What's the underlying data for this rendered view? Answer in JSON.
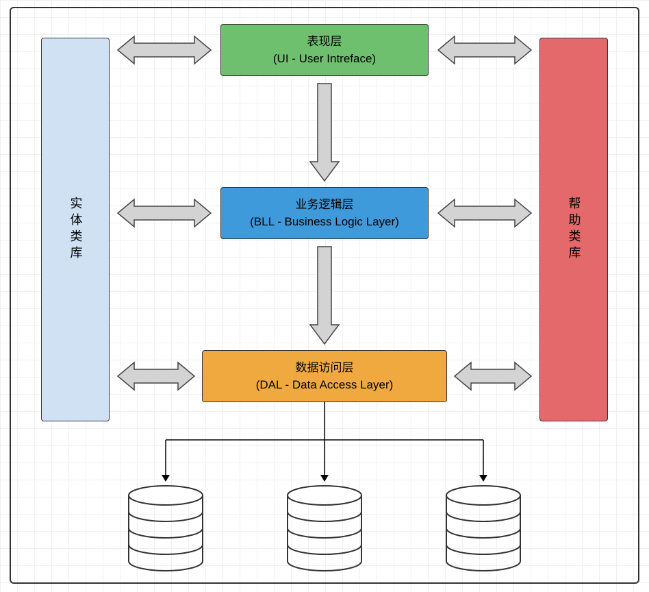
{
  "layers": {
    "ui": {
      "title": "表现层",
      "subtitle": "(UI - User Intreface)"
    },
    "bll": {
      "title": "业务逻辑层",
      "subtitle": "(BLL - Business Logic Layer)"
    },
    "dal": {
      "title": "数据访问层",
      "subtitle": "(DAL - Data Access Layer)"
    }
  },
  "side": {
    "left": "实体类库",
    "right": "帮助类库"
  },
  "colors": {
    "ui": "#6EBF6E",
    "bll": "#3E9ADB",
    "dal": "#F0A93F",
    "left": "#CFE1F3",
    "right": "#E4696A",
    "arrow_fill": "#D3D3D3",
    "arrow_stroke": "#444",
    "frame": "#333"
  },
  "databases": {
    "count": 3
  }
}
